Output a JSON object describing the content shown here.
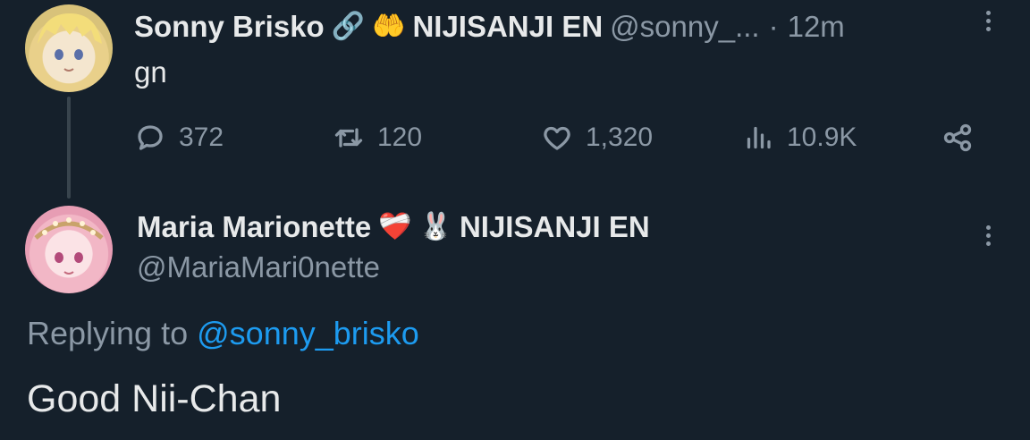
{
  "tweet": {
    "author_name": "Sonny Brisko",
    "badge_emoji_1": "🔗",
    "badge_emoji_2": "🤲",
    "org": "NIJISANJI EN",
    "handle": "@sonny_...",
    "separator": "·",
    "time": "12m",
    "text": "gn",
    "stats": {
      "replies": "372",
      "retweets": "120",
      "likes": "1,320",
      "views": "10.9K"
    }
  },
  "reply": {
    "author_name": "Maria Marionette",
    "badge_emoji_1": "❤️‍🩹",
    "badge_emoji_2": "🐰",
    "org": "NIJISANJI EN",
    "handle": "@MariaMari0nette",
    "replying_prefix": "Replying to",
    "replying_handle": "@sonny_brisko",
    "text": "Good Nii-Chan"
  },
  "colors": {
    "background": "#15202b",
    "text": "#e7e9ea",
    "muted": "#8b98a5",
    "link": "#1d9bf0"
  },
  "icons": [
    "reply-icon",
    "retweet-icon",
    "like-icon",
    "views-icon",
    "share-icon",
    "more-icon"
  ]
}
